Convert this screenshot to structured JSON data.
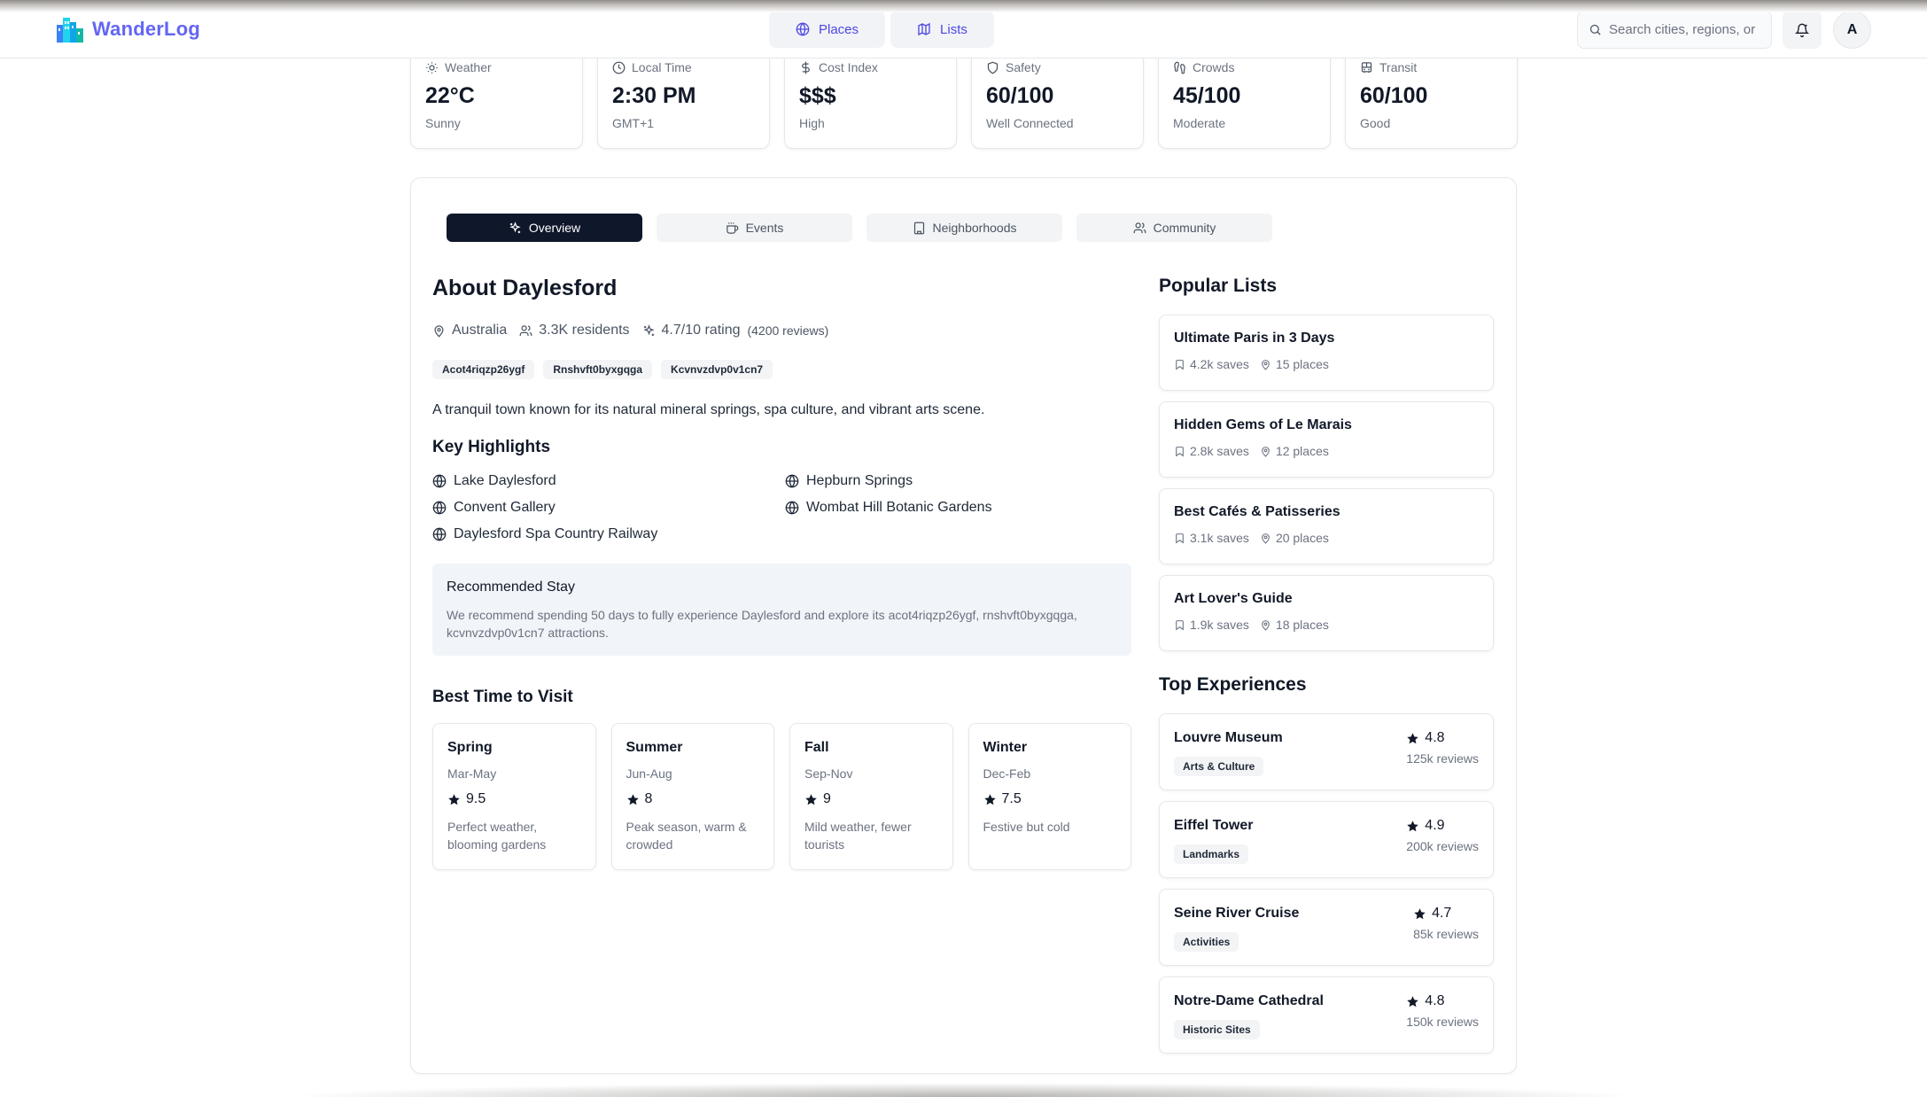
{
  "app": {
    "name": "WanderLog"
  },
  "nav": {
    "tabs": [
      {
        "label": "Places",
        "icon": "globe-icon"
      },
      {
        "label": "Lists",
        "icon": "map-icon"
      }
    ],
    "search_placeholder": "Search cities, regions, or",
    "avatar_initial": "A"
  },
  "stats": [
    {
      "label": "Weather",
      "value": "22°C",
      "sub": "Sunny",
      "icon": "sun-icon"
    },
    {
      "label": "Local Time",
      "value": "2:30 PM",
      "sub": "GMT+1",
      "icon": "clock-icon"
    },
    {
      "label": "Cost Index",
      "value": "$$$",
      "sub": "High",
      "icon": "dollar-icon"
    },
    {
      "label": "Safety",
      "value": "60/100",
      "sub": "Well Connected",
      "icon": "shield-icon"
    },
    {
      "label": "Crowds",
      "value": "45/100",
      "sub": "Moderate",
      "icon": "footprints-icon"
    },
    {
      "label": "Transit",
      "value": "60/100",
      "sub": "Good",
      "icon": "bus-icon"
    }
  ],
  "tabs": [
    {
      "label": "Overview",
      "icon": "sparkles-icon",
      "active": true
    },
    {
      "label": "Events",
      "icon": "coffee-icon",
      "active": false
    },
    {
      "label": "Neighborhoods",
      "icon": "building-icon",
      "active": false
    },
    {
      "label": "Community",
      "icon": "users-icon",
      "active": false
    }
  ],
  "about": {
    "title": "About Daylesford",
    "country": "Australia",
    "residents": "3.3K residents",
    "rating": "4.7/10 rating",
    "reviews": "(4200 reviews)",
    "tags": [
      "Acot4riqzp26ygf",
      "Rnshvft0byxgqga",
      "Kcvnvzdvp0v1cn7"
    ],
    "description": "A tranquil town known for its natural mineral springs, spa culture, and vibrant arts scene."
  },
  "highlights": {
    "title": "Key Highlights",
    "items": [
      "Lake Daylesford",
      "Hepburn Springs",
      "Convent Gallery",
      "Wombat Hill Botanic Gardens",
      "Daylesford Spa Country Railway"
    ]
  },
  "stay": {
    "title": "Recommended Stay",
    "text": "We recommend spending 50 days to fully experience Daylesford and explore its acot4riqzp26ygf, rnshvft0byxgqga, kcvnvzdvp0v1cn7 attractions."
  },
  "best_time": {
    "title": "Best Time to Visit",
    "seasons": [
      {
        "name": "Spring",
        "months": "Mar-May",
        "score": "9.5",
        "note": "Perfect weather, blooming gardens"
      },
      {
        "name": "Summer",
        "months": "Jun-Aug",
        "score": "8",
        "note": "Peak season, warm & crowded"
      },
      {
        "name": "Fall",
        "months": "Sep-Nov",
        "score": "9",
        "note": "Mild weather, fewer tourists"
      },
      {
        "name": "Winter",
        "months": "Dec-Feb",
        "score": "7.5",
        "note": "Festive but cold"
      }
    ]
  },
  "popular_lists": {
    "title": "Popular Lists",
    "items": [
      {
        "name": "Ultimate Paris in 3 Days",
        "saves": "4.2k saves",
        "places": "15 places"
      },
      {
        "name": "Hidden Gems of Le Marais",
        "saves": "2.8k saves",
        "places": "12 places"
      },
      {
        "name": "Best Cafés & Patisseries",
        "saves": "3.1k saves",
        "places": "20 places"
      },
      {
        "name": "Art Lover's Guide",
        "saves": "1.9k saves",
        "places": "18 places"
      }
    ]
  },
  "top_experiences": {
    "title": "Top Experiences",
    "items": [
      {
        "name": "Louvre Museum",
        "category": "Arts & Culture",
        "rating": "4.8",
        "reviews": "125k reviews"
      },
      {
        "name": "Eiffel Tower",
        "category": "Landmarks",
        "rating": "4.9",
        "reviews": "200k reviews"
      },
      {
        "name": "Seine River Cruise",
        "category": "Activities",
        "rating": "4.7",
        "reviews": "85k reviews"
      },
      {
        "name": "Notre-Dame Cathedral",
        "category": "Historic Sites",
        "rating": "4.8",
        "reviews": "150k reviews"
      }
    ]
  },
  "colors": {
    "brand": "#6366f1",
    "active_tab": "#0f172a",
    "muted_text": "#6b7280"
  }
}
